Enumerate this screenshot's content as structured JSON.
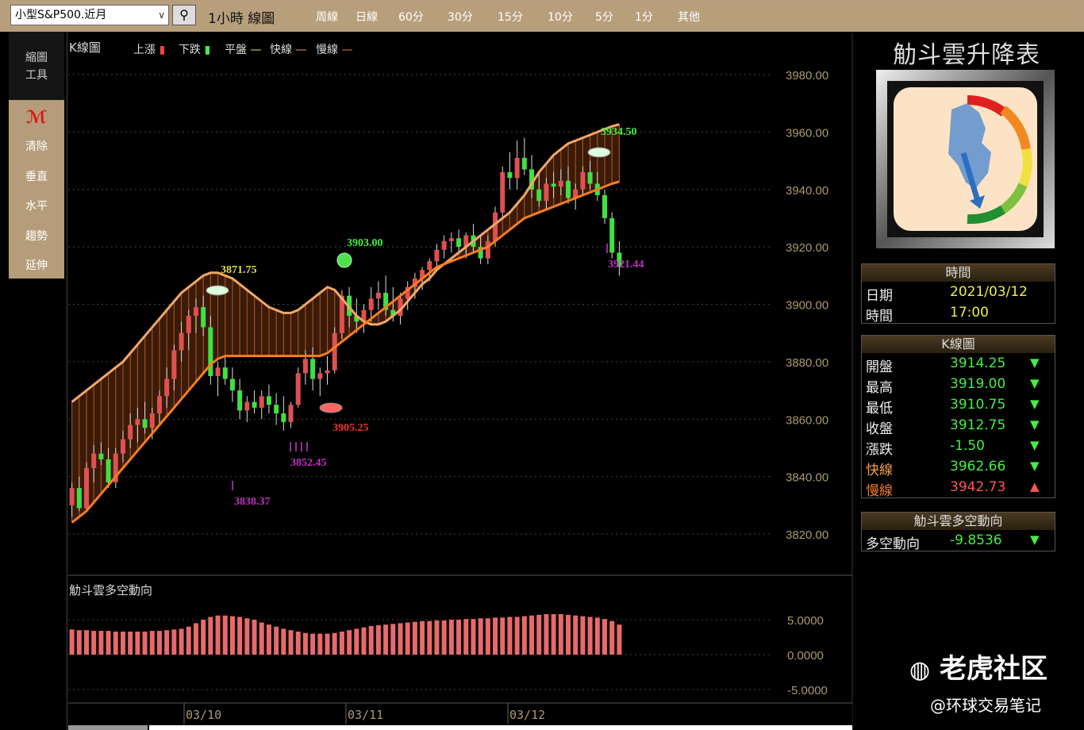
{
  "toolbar": {
    "symbol": "小型S&P500.近月",
    "chart_title": "1小時 線圖",
    "periods": [
      "周線",
      "日線",
      "60分",
      "30分",
      "15分",
      "10分",
      "5分",
      "1分",
      "其他"
    ]
  },
  "tools": {
    "top": "縮圖\n工具",
    "items": [
      "清除",
      "垂直",
      "水平",
      "趨勢",
      "延伸"
    ]
  },
  "main_chart": {
    "title": "K線圖",
    "legend": [
      {
        "label": "上漲",
        "color": "#e44"
      },
      {
        "label": "下跌",
        "color": "#4e4"
      },
      {
        "label": "平盤",
        "color": "#ee4"
      },
      {
        "label": "快線",
        "color": "#f0a050"
      },
      {
        "label": "慢線",
        "color": "#f07a20"
      }
    ],
    "y_ticks": [
      "3980.00",
      "3960.00",
      "3940.00",
      "3920.00",
      "3900.00",
      "3880.00",
      "3860.00",
      "3840.00",
      "3820.00"
    ],
    "annotations": [
      "3871.75",
      "3903.00",
      "3934.50",
      "3905.25",
      "3852.45",
      "3838.37",
      "3921.44"
    ]
  },
  "sub_chart": {
    "title": "觔斗雲多空動向",
    "y_ticks": [
      "5.0000",
      "0.0000",
      "-5.0000"
    ]
  },
  "x_ticks": [
    "03/10",
    "03/11",
    "03/12"
  ],
  "right_panel": {
    "title": "觔斗雲升降表",
    "time_box": {
      "head": "時間",
      "rows": [
        {
          "k": "日期",
          "v": "2021/03/12"
        },
        {
          "k": "時間",
          "v": "17:00"
        }
      ]
    },
    "k_box": {
      "head": "K線圖",
      "rows": [
        {
          "k": "開盤",
          "v": "3914.25",
          "dir": "▼"
        },
        {
          "k": "最高",
          "v": "3919.00",
          "dir": "▼"
        },
        {
          "k": "最低",
          "v": "3910.75",
          "dir": "▼"
        },
        {
          "k": "收盤",
          "v": "3912.75",
          "dir": "▼"
        },
        {
          "k": "漲跌",
          "v": "-1.50",
          "dir": "▼"
        },
        {
          "k": "快線",
          "v": "3962.66",
          "dir": "▼"
        },
        {
          "k": "慢線",
          "v": "3942.73",
          "dir": "▲"
        }
      ]
    },
    "trend_box": {
      "head": "觔斗雲多空動向",
      "rows": [
        {
          "k": "多空動向",
          "v": "-9.8536",
          "dir": "▼"
        }
      ]
    }
  },
  "watermark": {
    "brand": "老虎社区",
    "handle": "@环球交易笔记"
  },
  "chart_data": {
    "type": "candlestick",
    "y_range": [
      3815,
      3990
    ],
    "candles": [
      [
        3830,
        3838,
        3826,
        3836
      ],
      [
        3836,
        3840,
        3828,
        3829
      ],
      [
        3829,
        3845,
        3828,
        3843
      ],
      [
        3843,
        3851,
        3838,
        3848
      ],
      [
        3848,
        3852,
        3844,
        3846
      ],
      [
        3846,
        3850,
        3836,
        3838
      ],
      [
        3838,
        3850,
        3836,
        3848
      ],
      [
        3848,
        3856,
        3845,
        3853
      ],
      [
        3853,
        3862,
        3850,
        3858
      ],
      [
        3858,
        3864,
        3852,
        3860
      ],
      [
        3860,
        3866,
        3855,
        3857
      ],
      [
        3857,
        3864,
        3853,
        3862
      ],
      [
        3862,
        3870,
        3858,
        3868
      ],
      [
        3868,
        3878,
        3864,
        3874
      ],
      [
        3874,
        3886,
        3870,
        3884
      ],
      [
        3884,
        3894,
        3880,
        3890
      ],
      [
        3890,
        3898,
        3884,
        3896
      ],
      [
        3896,
        3902,
        3890,
        3899
      ],
      [
        3899,
        3903,
        3889,
        3892
      ],
      [
        3892,
        3896,
        3872,
        3875
      ],
      [
        3875,
        3880,
        3868,
        3878
      ],
      [
        3878,
        3882,
        3872,
        3874
      ],
      [
        3874,
        3878,
        3866,
        3870
      ],
      [
        3870,
        3874,
        3860,
        3863
      ],
      [
        3863,
        3868,
        3859,
        3866
      ],
      [
        3866,
        3870,
        3862,
        3864
      ],
      [
        3864,
        3870,
        3860,
        3868
      ],
      [
        3868,
        3872,
        3862,
        3865
      ],
      [
        3865,
        3869,
        3858,
        3862
      ],
      [
        3862,
        3868,
        3856,
        3859
      ],
      [
        3859,
        3866,
        3857,
        3865
      ],
      [
        3865,
        3878,
        3864,
        3876
      ],
      [
        3876,
        3884,
        3872,
        3881
      ],
      [
        3881,
        3885,
        3870,
        3874
      ],
      [
        3874,
        3878,
        3868,
        3876
      ],
      [
        3876,
        3882,
        3872,
        3877
      ],
      [
        3877,
        3892,
        3876,
        3890
      ],
      [
        3890,
        3905,
        3888,
        3903
      ],
      [
        3903,
        3906,
        3892,
        3896
      ],
      [
        3896,
        3902,
        3890,
        3894
      ],
      [
        3894,
        3900,
        3890,
        3898
      ],
      [
        3898,
        3906,
        3894,
        3902
      ],
      [
        3902,
        3908,
        3898,
        3904
      ],
      [
        3904,
        3910,
        3896,
        3898
      ],
      [
        3898,
        3906,
        3894,
        3896
      ],
      [
        3896,
        3904,
        3893,
        3902
      ],
      [
        3902,
        3908,
        3898,
        3906
      ],
      [
        3906,
        3911,
        3902,
        3909
      ],
      [
        3909,
        3913,
        3905,
        3912
      ],
      [
        3912,
        3916,
        3908,
        3915
      ],
      [
        3915,
        3921,
        3912,
        3919
      ],
      [
        3919,
        3924,
        3916,
        3922
      ],
      [
        3922,
        3925,
        3918,
        3923
      ],
      [
        3923,
        3926,
        3918,
        3920
      ],
      [
        3920,
        3925,
        3916,
        3924
      ],
      [
        3924,
        3928,
        3918,
        3920
      ],
      [
        3920,
        3924,
        3914,
        3916
      ],
      [
        3916,
        3924,
        3914,
        3922
      ],
      [
        3922,
        3934,
        3920,
        3932
      ],
      [
        3932,
        3948,
        3930,
        3946
      ],
      [
        3946,
        3953,
        3940,
        3944
      ],
      [
        3944,
        3957,
        3940,
        3951
      ],
      [
        3951,
        3958,
        3945,
        3947
      ],
      [
        3947,
        3952,
        3937,
        3940
      ],
      [
        3940,
        3946,
        3934,
        3936
      ],
      [
        3936,
        3944,
        3933,
        3942
      ],
      [
        3942,
        3946,
        3937,
        3941
      ],
      [
        3941,
        3947,
        3938,
        3943
      ],
      [
        3943,
        3948,
        3935,
        3937
      ],
      [
        3937,
        3942,
        3933,
        3940
      ],
      [
        3940,
        3948,
        3938,
        3946
      ],
      [
        3946,
        3950,
        3940,
        3942
      ],
      [
        3942,
        3946,
        3936,
        3938
      ],
      [
        3938,
        3940,
        3928,
        3930
      ],
      [
        3930,
        3932,
        3916,
        3918
      ],
      [
        3918,
        3922,
        3910,
        3913
      ]
    ],
    "fast_line": [
      3866,
      3868,
      3870,
      3872,
      3874,
      3876,
      3878,
      3880,
      3883,
      3886,
      3889,
      3892,
      3895,
      3898,
      3901,
      3904,
      3906,
      3908,
      3910,
      3911,
      3911,
      3910,
      3909,
      3907,
      3905,
      3903,
      3901,
      3899,
      3898,
      3897,
      3897,
      3898,
      3900,
      3902,
      3904,
      3906,
      3905,
      3902,
      3899,
      3896,
      3894,
      3893,
      3893,
      3894,
      3896,
      3898,
      3901,
      3904,
      3907,
      3909,
      3912,
      3914,
      3916,
      3918,
      3920,
      3922,
      3924,
      3926,
      3928,
      3930,
      3932,
      3935,
      3938,
      3942,
      3946,
      3949,
      3952,
      3954,
      3956,
      3957,
      3958,
      3959,
      3960,
      3961,
      3962,
      3962.66
    ],
    "slow_line": [
      3824,
      3826,
      3828,
      3831,
      3834,
      3837,
      3840,
      3843,
      3846,
      3849,
      3852,
      3855,
      3858,
      3861,
      3864,
      3867,
      3870,
      3873,
      3876,
      3879,
      3881,
      3882,
      3882,
      3882,
      3882,
      3882,
      3882,
      3882,
      3882,
      3882,
      3882,
      3882,
      3882,
      3882,
      3882,
      3883,
      3885,
      3887,
      3889,
      3891,
      3893,
      3895,
      3897,
      3899,
      3901,
      3903,
      3905,
      3907,
      3909,
      3911,
      3913,
      3914,
      3915,
      3916,
      3917,
      3918,
      3919,
      3920,
      3922,
      3924,
      3926,
      3928,
      3930,
      3931,
      3932,
      3933,
      3934,
      3935,
      3936,
      3937,
      3938,
      3939,
      3940,
      3941,
      3942,
      3942.73
    ],
    "trend_values": [
      3.6,
      3.5,
      3.5,
      3.4,
      3.4,
      3.4,
      3.3,
      3.3,
      3.3,
      3.3,
      3.3,
      3.4,
      3.4,
      3.5,
      3.6,
      3.7,
      4.0,
      4.5,
      5.0,
      5.4,
      5.6,
      5.6,
      5.5,
      5.4,
      5.2,
      5.0,
      4.6,
      4.3,
      4.0,
      3.7,
      3.5,
      3.3,
      3.1,
      3.0,
      3.0,
      3.0,
      3.1,
      3.3,
      3.5,
      3.7,
      3.9,
      4.1,
      4.2,
      4.3,
      4.4,
      4.5,
      4.6,
      4.7,
      4.8,
      4.8,
      4.9,
      4.9,
      5.0,
      5.0,
      5.1,
      5.1,
      5.2,
      5.2,
      5.3,
      5.3,
      5.4,
      5.4,
      5.5,
      5.6,
      5.7,
      5.8,
      5.8,
      5.8,
      5.7,
      5.6,
      5.5,
      5.4,
      5.3,
      5.1,
      4.8,
      4.3
    ],
    "trend_range": [
      -5.5,
      7
    ]
  }
}
